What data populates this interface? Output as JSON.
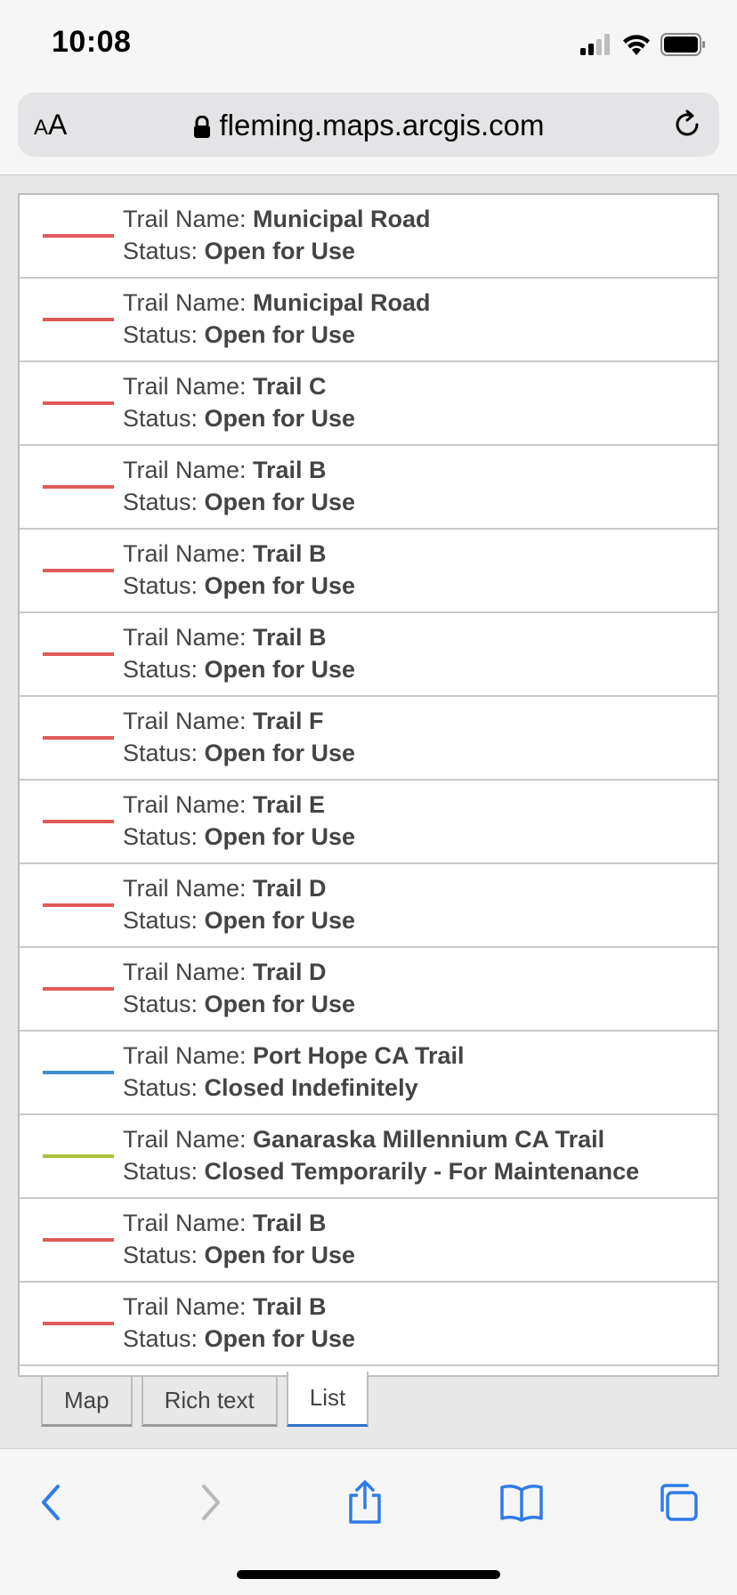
{
  "status_bar": {
    "time": "10:08"
  },
  "browser": {
    "text_size_small": "A",
    "text_size_large": "A",
    "url": "fleming.maps.arcgis.com"
  },
  "colors": {
    "open": "#e05a57",
    "closed_indef": "#3d8fd1",
    "closed_temp": "#aac23b",
    "tab_active": "#2f6fc9"
  },
  "list": {
    "name_label": "Trail Name: ",
    "status_label": "Status: ",
    "items": [
      {
        "name": "Municipal Road",
        "status": "Open for Use",
        "color": "#e05a57"
      },
      {
        "name": "Municipal Road",
        "status": "Open for Use",
        "color": "#e05a57"
      },
      {
        "name": "Trail C",
        "status": "Open for Use",
        "color": "#e05a57"
      },
      {
        "name": "Trail B",
        "status": "Open for Use",
        "color": "#e05a57"
      },
      {
        "name": "Trail B",
        "status": "Open for Use",
        "color": "#e05a57"
      },
      {
        "name": "Trail B",
        "status": "Open for Use",
        "color": "#e05a57"
      },
      {
        "name": "Trail F",
        "status": "Open for Use",
        "color": "#e05a57"
      },
      {
        "name": "Trail E",
        "status": "Open for Use",
        "color": "#e05a57"
      },
      {
        "name": "Trail D",
        "status": "Open for Use",
        "color": "#e05a57"
      },
      {
        "name": "Trail D",
        "status": "Open for Use",
        "color": "#e05a57"
      },
      {
        "name": "Port Hope CA Trail",
        "status": "Closed Indefinitely",
        "color": "#3d8fd1"
      },
      {
        "name": "Ganaraska Millennium CA Trail",
        "status": "Closed Temporarily - For Maintenance",
        "color": "#aac23b"
      },
      {
        "name": "Trail B",
        "status": "Open for Use",
        "color": "#e05a57"
      },
      {
        "name": "Trail B",
        "status": "Open for Use",
        "color": "#e05a57"
      }
    ]
  },
  "tabs": [
    {
      "label": "Map",
      "active": false
    },
    {
      "label": "Rich text",
      "active": false
    },
    {
      "label": "List",
      "active": true
    }
  ],
  "toolbar": {
    "icons": [
      "back-icon",
      "forward-icon",
      "share-icon",
      "bookmarks-icon",
      "tabs-icon"
    ]
  }
}
